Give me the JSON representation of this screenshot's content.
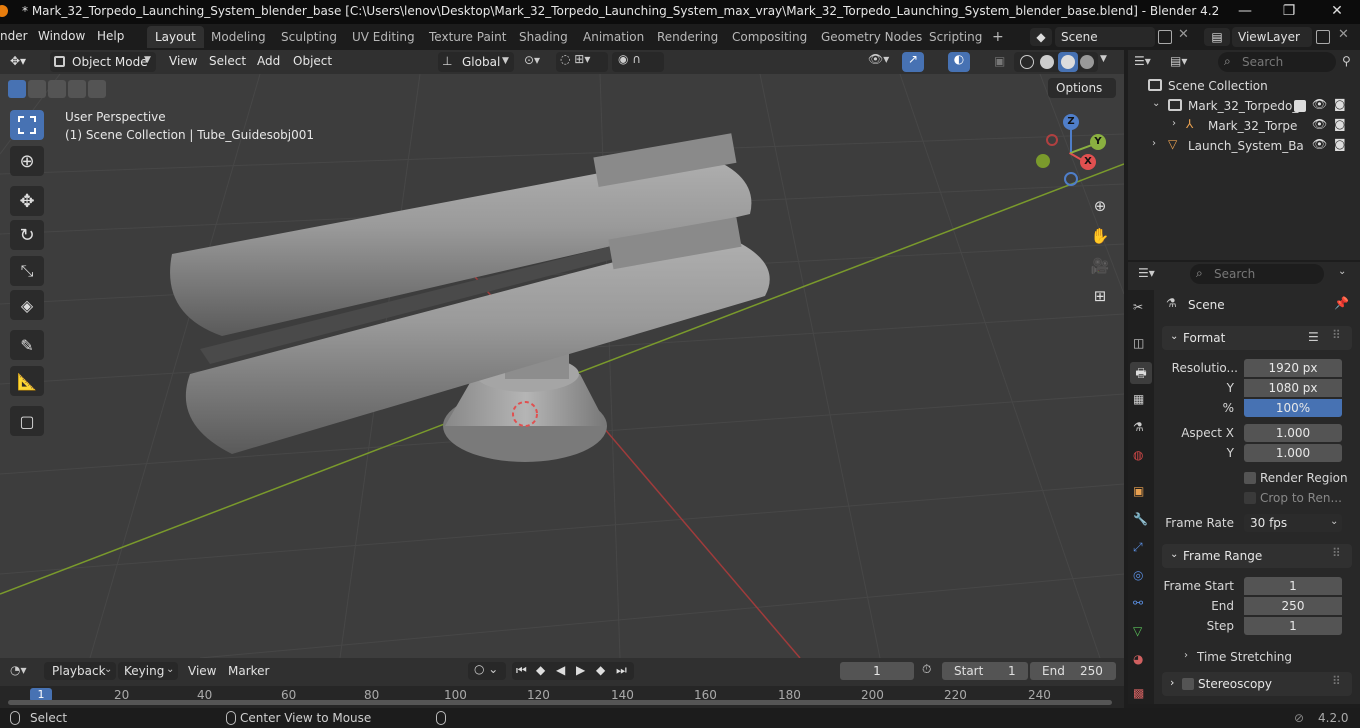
{
  "titlebar": {
    "title": "* Mark_32_Torpedo_Launching_System_blender_base [C:\\Users\\lenov\\Desktop\\Mark_32_Torpedo_Launching_System_max_vray\\Mark_32_Torpedo_Launching_System_blender_base.blend] - Blender 4.2",
    "minimize": "—",
    "maximize": "❐",
    "close": "✕"
  },
  "menubar": {
    "items": [
      "nder",
      "Window",
      "Help"
    ]
  },
  "workspaces": [
    "Layout",
    "Modeling",
    "Sculpting",
    "UV Editing",
    "Texture Paint",
    "Shading",
    "Animation",
    "Rendering",
    "Compositing",
    "Geometry Nodes",
    "Scripting"
  ],
  "add_workspace": "+",
  "scene_field": "Scene",
  "viewlayer_field": "ViewLayer",
  "viewport_header": {
    "mode": "Object Mode",
    "menus": [
      "View",
      "Select",
      "Add",
      "Object"
    ],
    "transform": "Global",
    "options": "Options"
  },
  "viewport": {
    "perspective": "User Perspective",
    "collection_info": "(1) Scene Collection | Tube_Guidesobj001",
    "gizmo": {
      "x": "X",
      "y": "Y",
      "z": "Z"
    }
  },
  "outliner": {
    "search_placeholder": "Search",
    "rows": [
      {
        "label": "Scene Collection"
      },
      {
        "label": "Mark_32_Torpedo_"
      },
      {
        "label": "Mark_32_Torpe"
      },
      {
        "label": "Launch_System_Ba"
      }
    ]
  },
  "properties": {
    "search_placeholder": "Search",
    "context": "Scene",
    "format_panel": "Format",
    "resolution_label": "Resolutio...",
    "resolution_x": "1920 px",
    "y_label": "Y",
    "resolution_y": "1080 px",
    "percent_label": "%",
    "resolution_pct": "100%",
    "aspect_x_label": "Aspect X",
    "aspect_x": "1.000",
    "aspect_y_label": "Y",
    "aspect_y": "1.000",
    "render_region": "Render Region",
    "crop_to_render": "Crop to Ren...",
    "frame_rate_label": "Frame Rate",
    "frame_rate": "30 fps",
    "frame_range_panel": "Frame Range",
    "frame_start_label": "Frame Start",
    "frame_start": "1",
    "end_label": "End",
    "frame_end": "250",
    "step_label": "Step",
    "frame_step": "1",
    "time_stretching": "Time Stretching",
    "stereoscopy": "Stereoscopy"
  },
  "timeline": {
    "menus": [
      "Playback",
      "Keying",
      "View",
      "Marker"
    ],
    "current_frame": "1",
    "start_label": "Start",
    "start": "1",
    "end_label": "End",
    "end": "250",
    "ticks": [
      "1",
      "20",
      "40",
      "60",
      "80",
      "100",
      "120",
      "140",
      "160",
      "180",
      "200",
      "220",
      "240"
    ]
  },
  "statusbar": {
    "select": "Select",
    "center_view": "Center View to Mouse",
    "version": "4.2.0"
  }
}
